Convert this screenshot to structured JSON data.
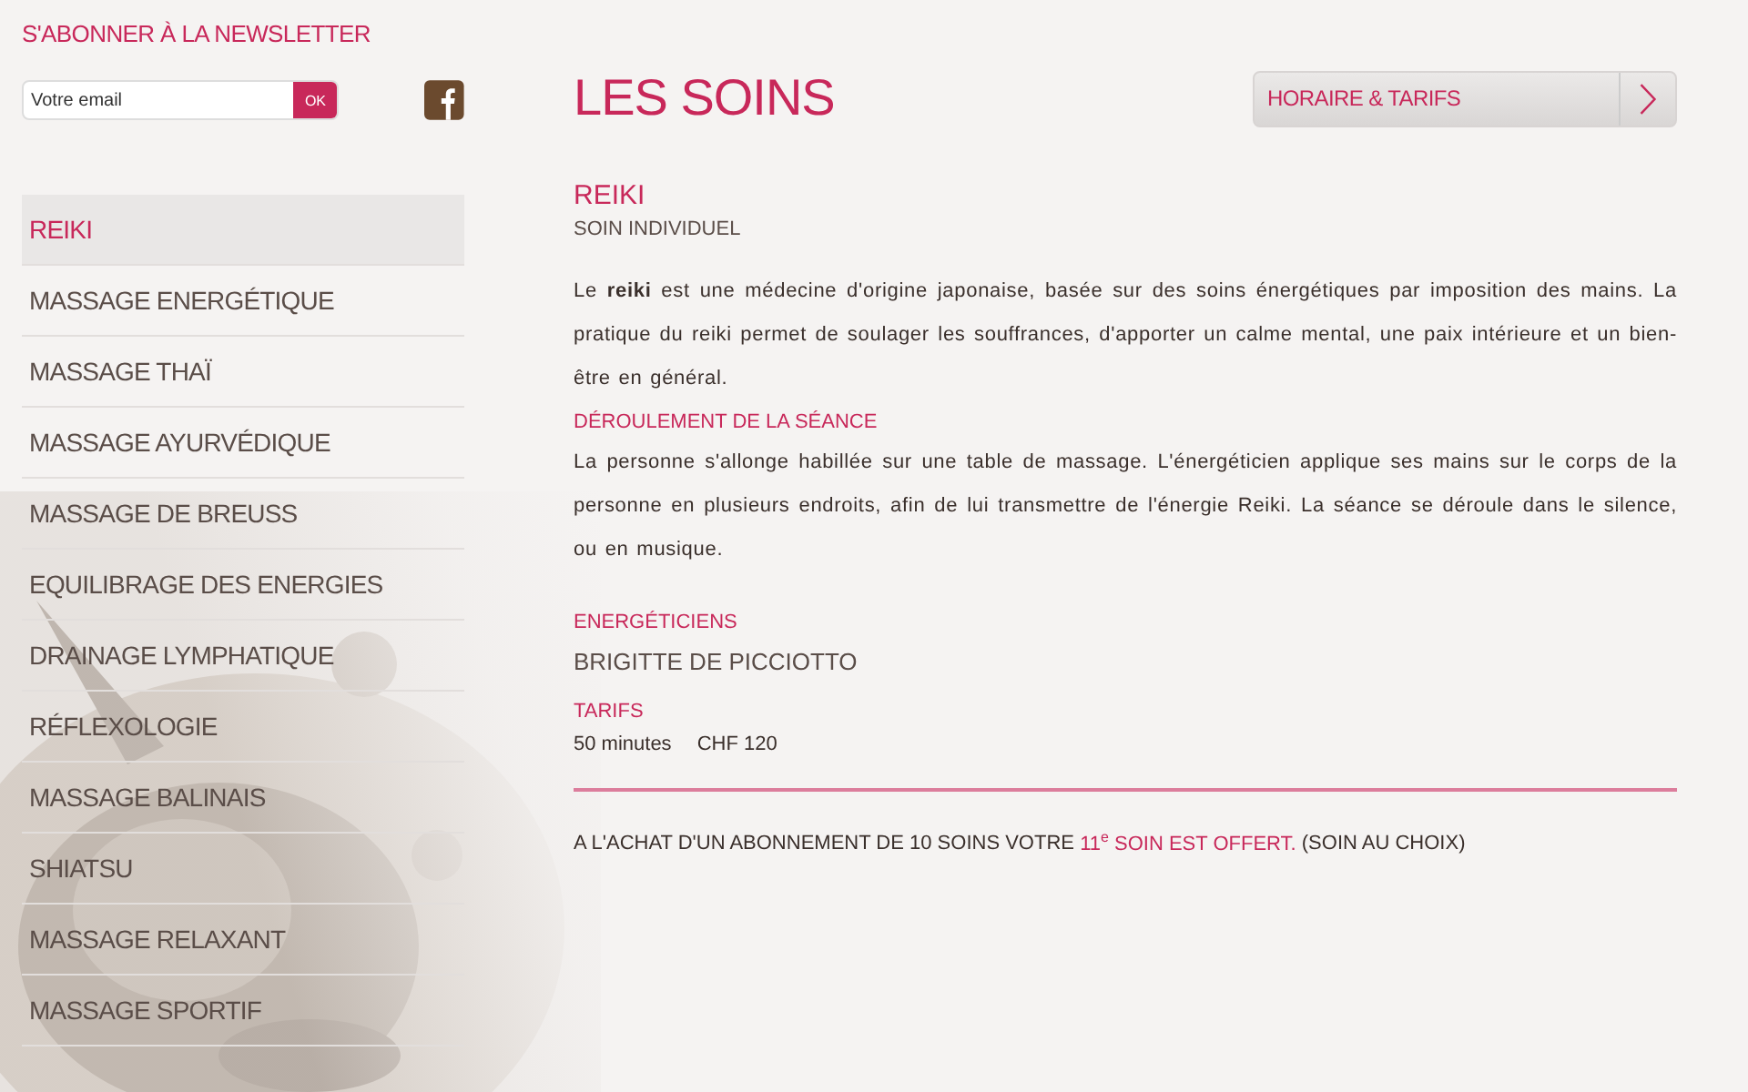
{
  "newsletter": {
    "title": "S'ABONNER À LA NEWSLETTER",
    "placeholder": "Votre email",
    "button": "OK"
  },
  "nav": [
    {
      "label": "REIKI",
      "selected": true
    },
    {
      "label": "MASSAGE ENERGÉTIQUE",
      "selected": false
    },
    {
      "label": "MASSAGE THAÏ",
      "selected": false
    },
    {
      "label": "MASSAGE AYURVÉDIQUE",
      "selected": false
    },
    {
      "label": "MASSAGE DE BREUSS",
      "selected": false
    },
    {
      "label": "EQUILIBRAGE DES ENERGIES",
      "selected": false
    },
    {
      "label": "DRAINAGE LYMPHATIQUE",
      "selected": false
    },
    {
      "label": "RÉFLEXOLOGIE",
      "selected": false
    },
    {
      "label": "MASSAGE BALINAIS",
      "selected": false
    },
    {
      "label": "SHIATSU",
      "selected": false
    },
    {
      "label": "MASSAGE RELAXANT",
      "selected": false
    },
    {
      "label": "MASSAGE SPORTIF",
      "selected": false
    }
  ],
  "page_title": "LES SOINS",
  "hours_button": "HORAIRE & TARIFS",
  "treatment": {
    "name": "REIKI",
    "type": "SOIN INDIVIDUEL",
    "description": "Le **reiki** est une médecine d'origine japonaise, basée sur des soins énergétiques par imposition des mains. La pratique du reiki permet de soulager les souffrances, d'apporter un calme mental, une paix intérieure et un bien-être en général.",
    "session_heading": "DÉROULEMENT DE LA SÉANCE",
    "session_text": "La personne s'allonge habillée sur une table de massage. L'énergéticien applique ses mains sur le corps de la personne en plusieurs endroits, afin de lui transmettre de l'énergie Reiki. La séance se déroule dans le silence, ou en musique.",
    "practitioners_heading": "ENERGÉTICIENS",
    "practitioners": [
      "BRIGITTE DE PICCIOTTO"
    ],
    "prices_heading": "TARIFS",
    "prices": [
      {
        "duration": "50 minutes",
        "price": "CHF 120"
      }
    ]
  },
  "offer": {
    "lead": "A L'ACHAT D'UN ABONNEMENT DE 10 SOINS VOTRE",
    "highlight": "11$^{e}$ SOIN EST OFFERT.",
    "tail": "(SOIN AU CHOIX)"
  }
}
